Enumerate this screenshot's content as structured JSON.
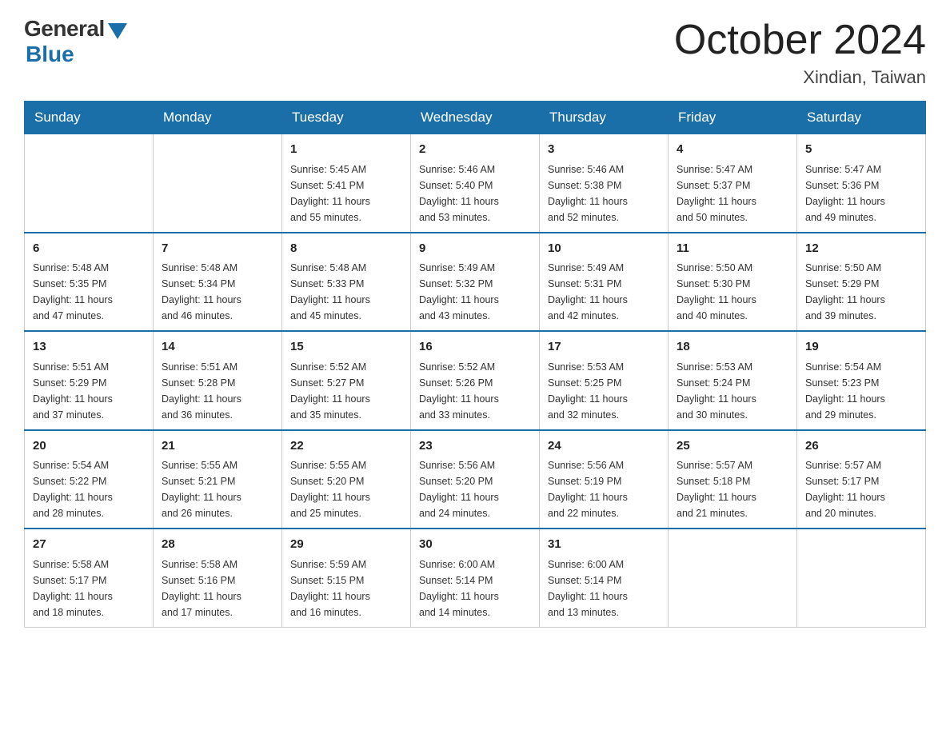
{
  "logo": {
    "general": "General",
    "blue": "Blue"
  },
  "title": "October 2024",
  "location": "Xindian, Taiwan",
  "days_of_week": [
    "Sunday",
    "Monday",
    "Tuesday",
    "Wednesday",
    "Thursday",
    "Friday",
    "Saturday"
  ],
  "weeks": [
    [
      {
        "day": "",
        "info": ""
      },
      {
        "day": "",
        "info": ""
      },
      {
        "day": "1",
        "info": "Sunrise: 5:45 AM\nSunset: 5:41 PM\nDaylight: 11 hours\nand 55 minutes."
      },
      {
        "day": "2",
        "info": "Sunrise: 5:46 AM\nSunset: 5:40 PM\nDaylight: 11 hours\nand 53 minutes."
      },
      {
        "day": "3",
        "info": "Sunrise: 5:46 AM\nSunset: 5:38 PM\nDaylight: 11 hours\nand 52 minutes."
      },
      {
        "day": "4",
        "info": "Sunrise: 5:47 AM\nSunset: 5:37 PM\nDaylight: 11 hours\nand 50 minutes."
      },
      {
        "day": "5",
        "info": "Sunrise: 5:47 AM\nSunset: 5:36 PM\nDaylight: 11 hours\nand 49 minutes."
      }
    ],
    [
      {
        "day": "6",
        "info": "Sunrise: 5:48 AM\nSunset: 5:35 PM\nDaylight: 11 hours\nand 47 minutes."
      },
      {
        "day": "7",
        "info": "Sunrise: 5:48 AM\nSunset: 5:34 PM\nDaylight: 11 hours\nand 46 minutes."
      },
      {
        "day": "8",
        "info": "Sunrise: 5:48 AM\nSunset: 5:33 PM\nDaylight: 11 hours\nand 45 minutes."
      },
      {
        "day": "9",
        "info": "Sunrise: 5:49 AM\nSunset: 5:32 PM\nDaylight: 11 hours\nand 43 minutes."
      },
      {
        "day": "10",
        "info": "Sunrise: 5:49 AM\nSunset: 5:31 PM\nDaylight: 11 hours\nand 42 minutes."
      },
      {
        "day": "11",
        "info": "Sunrise: 5:50 AM\nSunset: 5:30 PM\nDaylight: 11 hours\nand 40 minutes."
      },
      {
        "day": "12",
        "info": "Sunrise: 5:50 AM\nSunset: 5:29 PM\nDaylight: 11 hours\nand 39 minutes."
      }
    ],
    [
      {
        "day": "13",
        "info": "Sunrise: 5:51 AM\nSunset: 5:29 PM\nDaylight: 11 hours\nand 37 minutes."
      },
      {
        "day": "14",
        "info": "Sunrise: 5:51 AM\nSunset: 5:28 PM\nDaylight: 11 hours\nand 36 minutes."
      },
      {
        "day": "15",
        "info": "Sunrise: 5:52 AM\nSunset: 5:27 PM\nDaylight: 11 hours\nand 35 minutes."
      },
      {
        "day": "16",
        "info": "Sunrise: 5:52 AM\nSunset: 5:26 PM\nDaylight: 11 hours\nand 33 minutes."
      },
      {
        "day": "17",
        "info": "Sunrise: 5:53 AM\nSunset: 5:25 PM\nDaylight: 11 hours\nand 32 minutes."
      },
      {
        "day": "18",
        "info": "Sunrise: 5:53 AM\nSunset: 5:24 PM\nDaylight: 11 hours\nand 30 minutes."
      },
      {
        "day": "19",
        "info": "Sunrise: 5:54 AM\nSunset: 5:23 PM\nDaylight: 11 hours\nand 29 minutes."
      }
    ],
    [
      {
        "day": "20",
        "info": "Sunrise: 5:54 AM\nSunset: 5:22 PM\nDaylight: 11 hours\nand 28 minutes."
      },
      {
        "day": "21",
        "info": "Sunrise: 5:55 AM\nSunset: 5:21 PM\nDaylight: 11 hours\nand 26 minutes."
      },
      {
        "day": "22",
        "info": "Sunrise: 5:55 AM\nSunset: 5:20 PM\nDaylight: 11 hours\nand 25 minutes."
      },
      {
        "day": "23",
        "info": "Sunrise: 5:56 AM\nSunset: 5:20 PM\nDaylight: 11 hours\nand 24 minutes."
      },
      {
        "day": "24",
        "info": "Sunrise: 5:56 AM\nSunset: 5:19 PM\nDaylight: 11 hours\nand 22 minutes."
      },
      {
        "day": "25",
        "info": "Sunrise: 5:57 AM\nSunset: 5:18 PM\nDaylight: 11 hours\nand 21 minutes."
      },
      {
        "day": "26",
        "info": "Sunrise: 5:57 AM\nSunset: 5:17 PM\nDaylight: 11 hours\nand 20 minutes."
      }
    ],
    [
      {
        "day": "27",
        "info": "Sunrise: 5:58 AM\nSunset: 5:17 PM\nDaylight: 11 hours\nand 18 minutes."
      },
      {
        "day": "28",
        "info": "Sunrise: 5:58 AM\nSunset: 5:16 PM\nDaylight: 11 hours\nand 17 minutes."
      },
      {
        "day": "29",
        "info": "Sunrise: 5:59 AM\nSunset: 5:15 PM\nDaylight: 11 hours\nand 16 minutes."
      },
      {
        "day": "30",
        "info": "Sunrise: 6:00 AM\nSunset: 5:14 PM\nDaylight: 11 hours\nand 14 minutes."
      },
      {
        "day": "31",
        "info": "Sunrise: 6:00 AM\nSunset: 5:14 PM\nDaylight: 11 hours\nand 13 minutes."
      },
      {
        "day": "",
        "info": ""
      },
      {
        "day": "",
        "info": ""
      }
    ]
  ]
}
